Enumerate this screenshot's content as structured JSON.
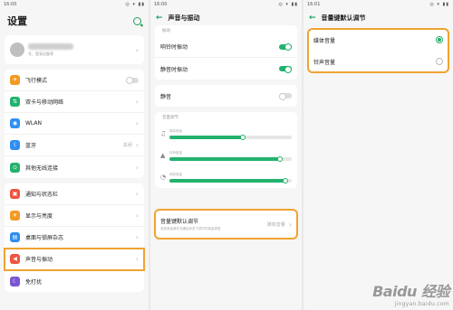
{
  "screen1": {
    "time": "16:00",
    "status_right": "◎ ▾ ▮▮",
    "title": "设置",
    "account_sub": "号、登录设备等",
    "group1": [
      {
        "label": "飞行模式",
        "icon": "airplane-icon",
        "color": "#f39a24",
        "glyph": "✈",
        "control": "toggle-off"
      },
      {
        "label": "双卡与移动网络",
        "icon": "sim-card-icon",
        "color": "#23b26d",
        "glyph": "⇅",
        "control": "chevron"
      },
      {
        "label": "WLAN",
        "icon": "wifi-icon",
        "color": "#2f8ef0",
        "glyph": "◉",
        "control": "chevron"
      },
      {
        "label": "蓝牙",
        "icon": "bluetooth-icon",
        "color": "#2f8ef0",
        "glyph": "ᛒ",
        "value": "关闭",
        "control": "chevron"
      },
      {
        "label": "其他无线连接",
        "icon": "wireless-icon",
        "color": "#23b26d",
        "glyph": "⊙",
        "control": "chevron"
      }
    ],
    "group2": [
      {
        "label": "通知与状态栏",
        "icon": "notification-icon",
        "color": "#f1543f",
        "glyph": "▣",
        "control": "chevron"
      },
      {
        "label": "显示与亮度",
        "icon": "brightness-icon",
        "color": "#f39a24",
        "glyph": "☀",
        "control": "chevron"
      },
      {
        "label": "桌面与锁屏杂志",
        "icon": "wallpaper-icon",
        "color": "#2f8ef0",
        "glyph": "▤",
        "control": "chevron"
      },
      {
        "label": "声音与振动",
        "icon": "sound-icon",
        "color": "#f1543f",
        "glyph": "◀",
        "control": "chevron",
        "highlight": true
      },
      {
        "label": "免打扰",
        "icon": "moon-icon",
        "color": "#7a57d1",
        "glyph": "☾",
        "control": "none"
      }
    ]
  },
  "screen2": {
    "time": "16:00",
    "status_right": "◎ ▾ ▮▮",
    "title": "声音与振动",
    "section_vibrate": "振动",
    "ring_vibrate": "响铃时振动",
    "silent_vibrate": "静音时振动",
    "mute": "静音",
    "section_volume": "音量调节",
    "volumes": [
      {
        "label": "媒体音量",
        "icon": "music-note-icon",
        "glyph": "♫",
        "level": 0.6
      },
      {
        "label": "铃声音量",
        "icon": "bell-icon",
        "glyph": "▲",
        "level": 0.9
      },
      {
        "label": "闹钟音量",
        "icon": "alarm-icon",
        "glyph": "◔",
        "level": 0.95
      }
    ],
    "vkd_title": "音量键默认调节",
    "vkd_desc": "选择音量键在非通话状态下调节的音量类型",
    "vkd_value": "媒体音量"
  },
  "screen3": {
    "time": "16:01",
    "status_right": "◎ ▾ ▮▮",
    "title": "音量键默认调节",
    "options": [
      {
        "label": "媒体音量",
        "selected": true
      },
      {
        "label": "铃声音量",
        "selected": false
      }
    ]
  },
  "watermark": {
    "main": "Baidu 经验",
    "sub": "jingyan.baidu.com"
  }
}
